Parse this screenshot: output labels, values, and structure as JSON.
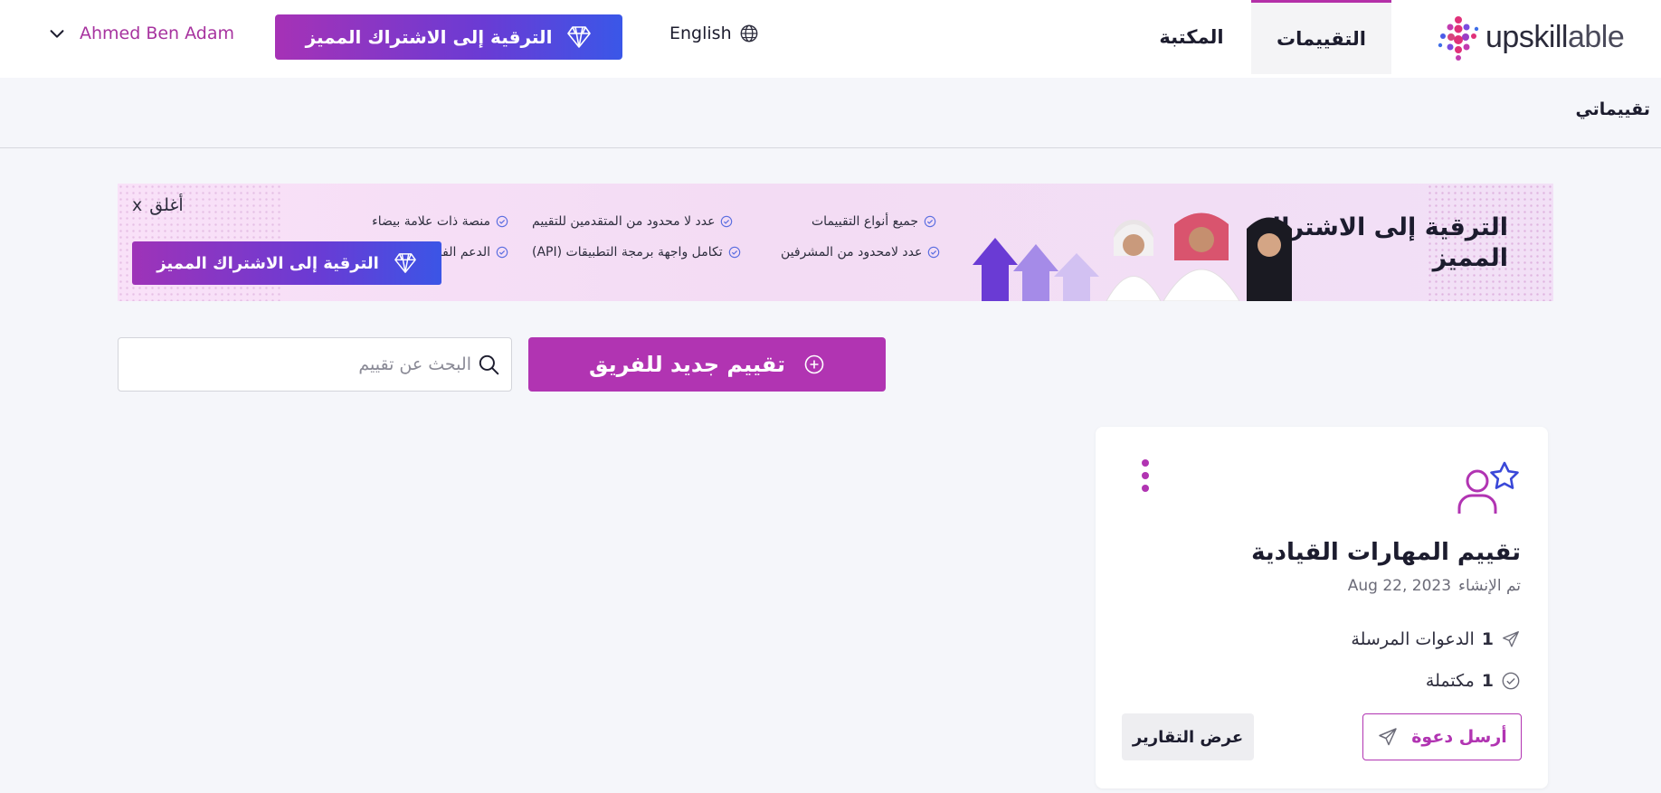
{
  "header": {
    "user_name": "Ahmed Ben Adam",
    "upgrade_label": "الترقية إلى الاشتراك المميز",
    "language_label": "English",
    "tabs": [
      {
        "label": "المكتبة"
      },
      {
        "label": "التقييمات"
      }
    ],
    "logo": {
      "part1": "upskill",
      "part2": "able"
    }
  },
  "breadcrumb": {
    "label": "تقييماتي"
  },
  "banner": {
    "title": "الترقية إلى الاشتراك المميز",
    "features": [
      "جميع أنواع التقييمات",
      "عدد لا محدود من المتقدمين للتقييم",
      "منصة ذات علامة بيضاء",
      "عدد لامحدود من المشرفين",
      "تكامل واجهة برمجة التطبيقات (API)",
      "الدعم الفني"
    ],
    "close_label": "أغلق",
    "close_x": "x",
    "button_label": "الترقية إلى الاشتراك المميز"
  },
  "actions": {
    "new_button_label": "تقييم جديد للفريق",
    "search_placeholder": "البحث عن تقييم"
  },
  "card": {
    "title": "تقييم المهارات القيادية",
    "created_label": "تم الإنشاء",
    "created_date": "Aug 22, 2023",
    "invites_count": "1",
    "invites_label": "الدعوات المرسلة",
    "completed_count": "1",
    "completed_label": "مكتملة",
    "send_invite_label": "أرسل دعوة",
    "view_reports_label": "عرض التقارير"
  },
  "colors": {
    "accent": "#b134b2",
    "gradient_start": "#a632b6",
    "gradient_end": "#3a57e8"
  }
}
